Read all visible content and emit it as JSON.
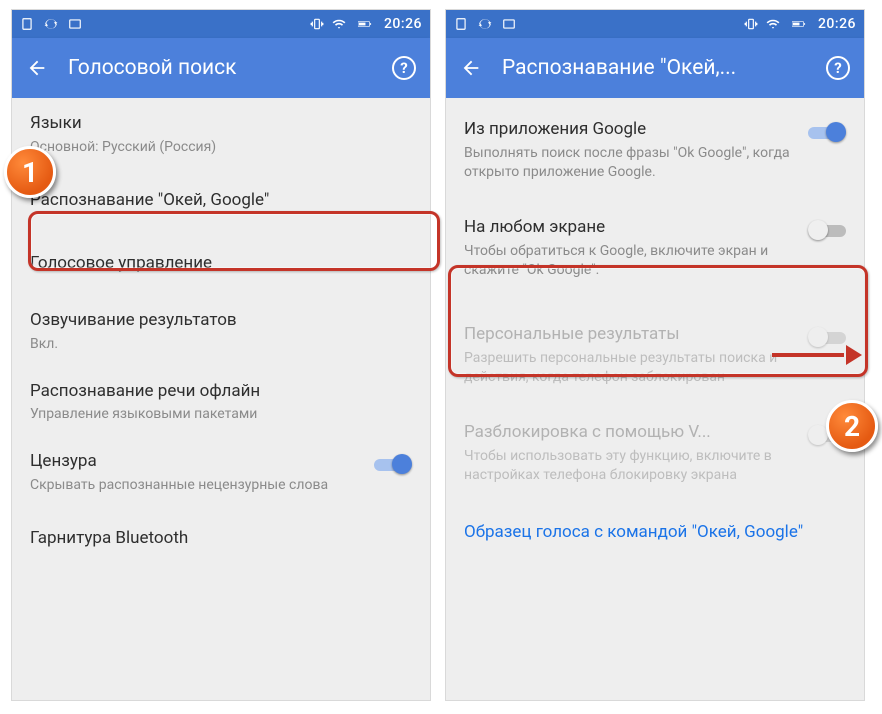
{
  "statusbar": {
    "time": "20:26"
  },
  "badges": {
    "one": "1",
    "two": "2"
  },
  "left": {
    "title": "Голосовой поиск",
    "rows": {
      "languages": {
        "title": "Языки",
        "sub": "Основной: Русский (Россия)"
      },
      "okgoogle": {
        "title": "Распознавание \"Окей, Google\""
      },
      "voicecontrol": {
        "title": "Голосовое управление"
      },
      "tts": {
        "title": "Озвучивание результатов",
        "sub": "Вкл."
      },
      "offline": {
        "title": "Распознавание речи офлайн",
        "sub": "Управление языковыми пакетами"
      },
      "censor": {
        "title": "Цензура",
        "sub": "Скрывать распознанные нецензурные слова",
        "on": true
      },
      "bluetooth": {
        "title": "Гарнитура Bluetooth"
      }
    }
  },
  "right": {
    "title": "Распознавание \"Окей,...",
    "rows": {
      "fromapp": {
        "title": "Из приложения Google",
        "sub": "Выполнять поиск после фразы \"Ok Google\", когда открыто приложение Google.",
        "on": true
      },
      "anyscreen": {
        "title": "На любом экране",
        "sub": "Чтобы обратиться к Google, включите экран и скажите \"Ok Google\".",
        "on": false
      },
      "personal": {
        "title": "Персональные результаты",
        "sub": "Разрешить персональные результаты поиска и действия, когда телефон заблокирован",
        "on": false
      },
      "unlock": {
        "title": "Разблокировка с помощью V...",
        "sub": "Чтобы использовать эту функцию, включите в настройках телефона блокировку экрана",
        "on": false
      },
      "sample": {
        "title": "Образец голоса с командой \"Окей, Google\""
      }
    }
  }
}
